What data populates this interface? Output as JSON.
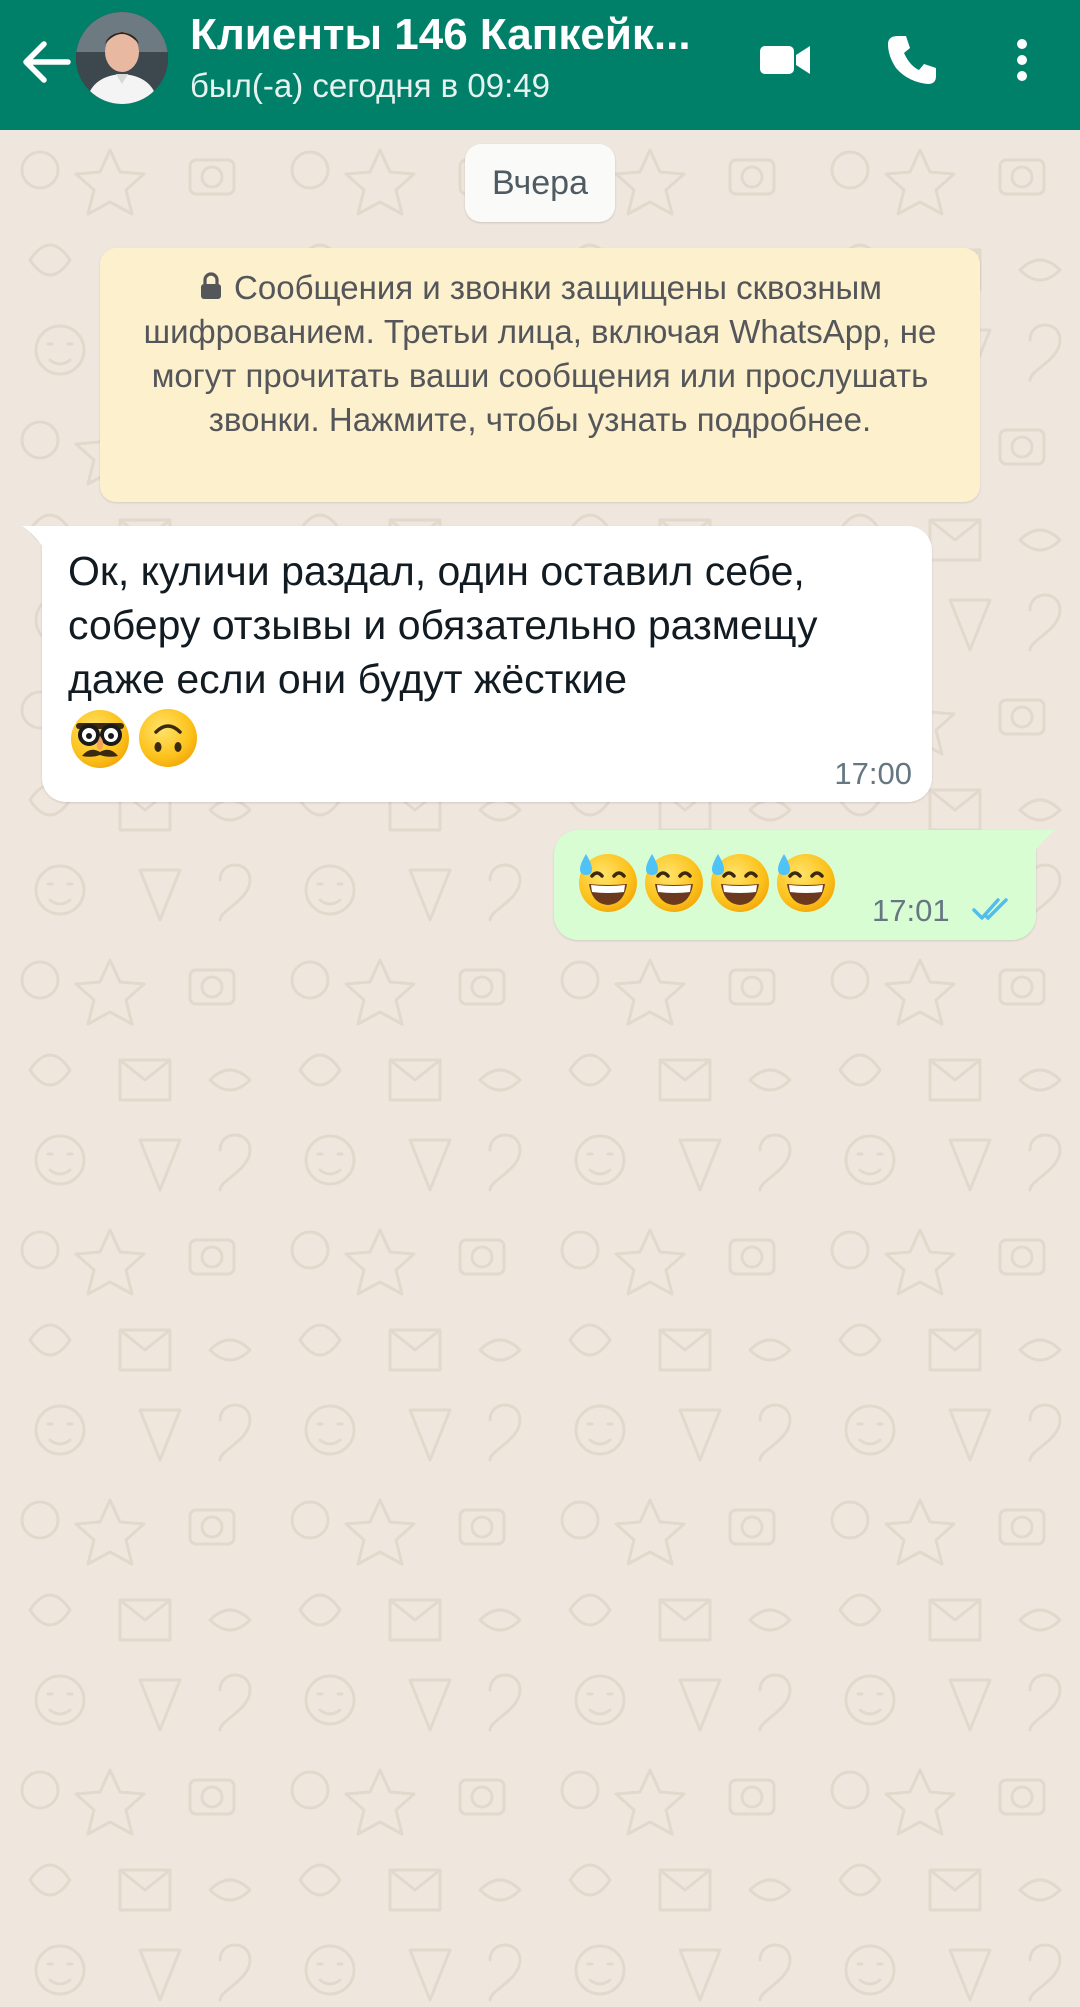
{
  "header": {
    "title": "Клиенты 146 Капкейк...",
    "status": "был(-а) сегодня в 09:49",
    "bg_color": "#008069",
    "icons": [
      "back-arrow-icon",
      "video-call-icon",
      "phone-icon",
      "more-vert-icon"
    ]
  },
  "chat": {
    "date_chip": "Вчера",
    "encryption_notice": "Сообщения и звонки защищены сквозным шифрованием. Третьи лица, включая WhatsApp, не могут прочитать ваши сообщения или прослушать звонки. Нажмите, чтобы узнать подробнее.",
    "messages": [
      {
        "direction": "incoming",
        "text": "Ок, куличи раздал, один оставил себе, соберу отзывы и обязательно размещу даже если они будут жёсткие",
        "emojis": [
          "disguised-face-emoji",
          "upside-down-face-emoji"
        ],
        "time": "17:00"
      },
      {
        "direction": "outgoing",
        "emojis": [
          "grinning-face-with-sweat-emoji",
          "grinning-face-with-sweat-emoji",
          "grinning-face-with-sweat-emoji",
          "grinning-face-with-sweat-emoji"
        ],
        "time": "17:01",
        "status": "read"
      }
    ]
  },
  "colors": {
    "chat_bg": "#efe7de",
    "incoming_bubble": "#ffffff",
    "outgoing_bubble": "#d9fdd3",
    "notice_bg": "#fcf0cd",
    "read_ticks": "#53bdeb"
  }
}
